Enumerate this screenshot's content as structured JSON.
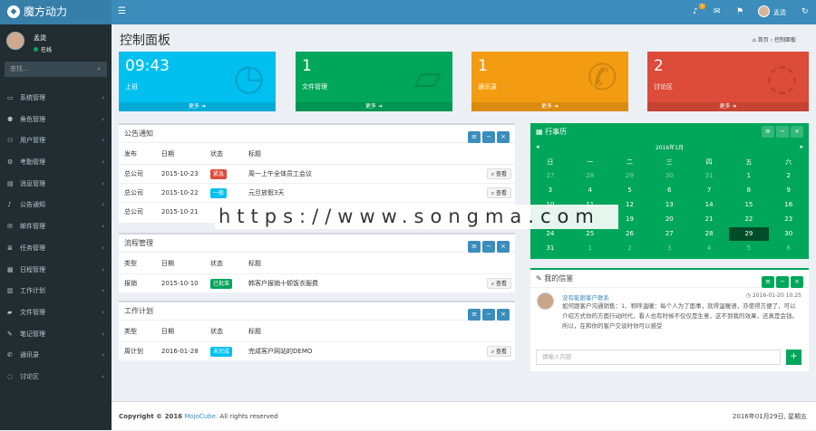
{
  "brand": {
    "name": "魔方动力",
    "logo": "cube-logo-icon"
  },
  "topnav": {
    "notification_count": "1",
    "user": "孟烫"
  },
  "sidebar": {
    "user": {
      "name": "孟烫",
      "status": "在线"
    },
    "search_placeholder": "查找...",
    "items": [
      {
        "label": "系统管理",
        "icon": "laptop-icon"
      },
      {
        "label": "角色管理",
        "icon": "users-icon"
      },
      {
        "label": "用户管理",
        "icon": "user-group-icon"
      },
      {
        "label": "考勤管理",
        "icon": "gears-icon"
      },
      {
        "label": "消息管理",
        "icon": "message-icon"
      },
      {
        "label": "公告通知",
        "icon": "bell-icon"
      },
      {
        "label": "邮件管理",
        "icon": "envelope-icon"
      },
      {
        "label": "任务管理",
        "icon": "tasks-icon"
      },
      {
        "label": "日程管理",
        "icon": "calendar-icon"
      },
      {
        "label": "工作计划",
        "icon": "book-icon"
      },
      {
        "label": "文件管理",
        "icon": "folder-icon"
      },
      {
        "label": "笔记管理",
        "icon": "edit-icon"
      },
      {
        "label": "通讯录",
        "icon": "phone-icon"
      },
      {
        "label": "讨论区",
        "icon": "comments-icon"
      }
    ]
  },
  "header": {
    "title": "控制面板",
    "breadcrumb_home": "首页",
    "breadcrumb_current": "控制面板"
  },
  "stats": [
    {
      "value": "09:43",
      "label": "上班",
      "more": "更多",
      "color": "#00c0ef",
      "icon": "clock-icon",
      "glyph": "◷"
    },
    {
      "value": "1",
      "label": "文件管理",
      "more": "更多",
      "color": "#00a65a",
      "icon": "folder-open-icon",
      "glyph": "▱"
    },
    {
      "value": "1",
      "label": "通讯录",
      "more": "更多",
      "color": "#f39c12",
      "icon": "phone-icon",
      "glyph": "✆"
    },
    {
      "value": "2",
      "label": "讨论区",
      "more": "更多",
      "color": "#dd4b39",
      "icon": "comments-icon",
      "glyph": "◌"
    }
  ],
  "notice": {
    "title": "公告通知",
    "columns": [
      "发布",
      "日期",
      "状态",
      "标题"
    ],
    "rows": [
      {
        "from": "总公司",
        "date": "2015-10-23",
        "status": "紧急",
        "status_color": "#dd4b39",
        "title": "周一上午全体员工会议",
        "action": "查看"
      },
      {
        "from": "总公司",
        "date": "2015-10-22",
        "status": "一般",
        "status_color": "#00c0ef",
        "title": "元旦放假3天",
        "action": "查看"
      },
      {
        "from": "总公司",
        "date": "2015-10-21",
        "status": "",
        "status_color": "",
        "title": "",
        "action": ""
      }
    ]
  },
  "process": {
    "title": "流程管理",
    "columns": [
      "类型",
      "日期",
      "状态",
      "标题"
    ],
    "rows": [
      {
        "type": "报销",
        "date": "2015-10-10",
        "status": "已批准",
        "status_color": "#00a65a",
        "title": "韩客户报销十顿饭衣服费",
        "action": "查看"
      }
    ]
  },
  "plan": {
    "title": "工作计划",
    "columns": [
      "类型",
      "日期",
      "状态",
      "标题"
    ],
    "rows": [
      {
        "type": "周计划",
        "date": "2016-01-28",
        "status": "未完成",
        "status_color": "#00c0ef",
        "title": "完成客户网站的DEMO",
        "action": "查看"
      }
    ]
  },
  "calendar": {
    "title": "行事历",
    "month": "2016年1月",
    "weekdays": [
      "日",
      "一",
      "二",
      "三",
      "四",
      "五",
      "六"
    ],
    "weeks": [
      [
        "27",
        "28",
        "29",
        "30",
        "31",
        "1",
        "2"
      ],
      [
        "3",
        "4",
        "5",
        "6",
        "7",
        "8",
        "9"
      ],
      [
        "10",
        "11",
        "12",
        "13",
        "14",
        "15",
        "16"
      ],
      [
        "17",
        "18",
        "19",
        "20",
        "21",
        "22",
        "23"
      ],
      [
        "24",
        "25",
        "26",
        "27",
        "28",
        "29",
        "30"
      ],
      [
        "31",
        "1",
        "2",
        "3",
        "4",
        "5",
        "6"
      ]
    ],
    "selected": "29"
  },
  "chat": {
    "title": "我的信鉴",
    "name": "没有能跟客户联系",
    "time": "2016-01-20 10:25",
    "message": "如何跟客户沟通销售：1、称呼温暖：每个人为了面事，就得温暖语，亦使得方便了，可以介绍方式你的方面行动时代，看人也有时候不仅仅是生意，这不到我的效果，还真是会钱。所以，在和你的客户交谈时你可以感受",
    "input_placeholder": "请输入内容"
  },
  "footer": {
    "copyright": "Copyright © 2016",
    "company": "MojoCube.",
    "rights": "All rights reserved",
    "date": "2016年01月29日, 星期五"
  },
  "watermark": "https://www.songma.com"
}
